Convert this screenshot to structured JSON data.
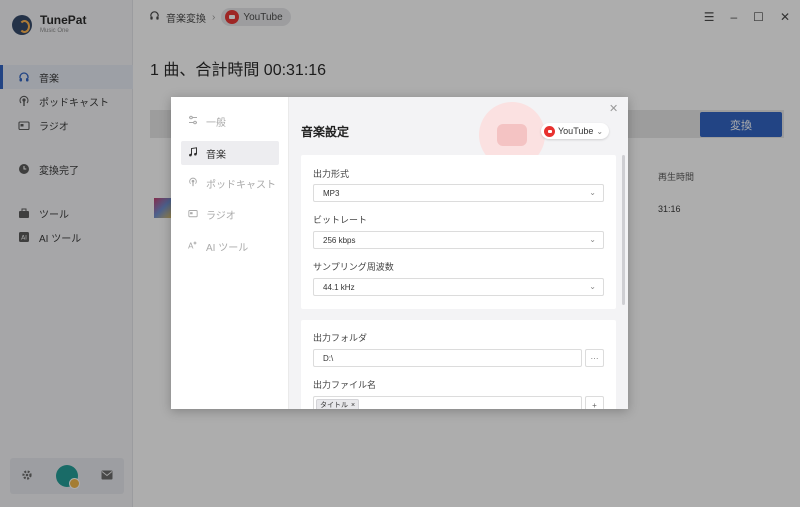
{
  "app": {
    "name": "TunePat",
    "subtitle": "Music One"
  },
  "sidebar": {
    "items": [
      {
        "label": "音楽",
        "icon": "headphones-icon",
        "active": true
      },
      {
        "label": "ポッドキャスト",
        "icon": "podcast-icon",
        "active": false
      },
      {
        "label": "ラジオ",
        "icon": "radio-icon",
        "active": false
      },
      {
        "label": "変換完了",
        "icon": "clock-icon",
        "active": false
      },
      {
        "label": "ツール",
        "icon": "toolbox-icon",
        "active": false
      },
      {
        "label": "AI ツール",
        "icon": "ai-icon",
        "active": false
      }
    ]
  },
  "topbar": {
    "crumb": "音楽変換",
    "source": "YouTube"
  },
  "main": {
    "title": "1 曲、合計時間 00:31:16",
    "convert_label": "変換",
    "column_duration": "再生時間",
    "track_duration": "31:16"
  },
  "dialog": {
    "nav": [
      {
        "label": "一般",
        "icon": "sliders-icon"
      },
      {
        "label": "音楽",
        "icon": "music-note-icon"
      },
      {
        "label": "ポッドキャスト",
        "icon": "podcast-icon"
      },
      {
        "label": "ラジオ",
        "icon": "radio-icon"
      },
      {
        "label": "AI ツール",
        "icon": "ai-icon"
      }
    ],
    "title": "音楽設定",
    "source": "YouTube",
    "output_format_label": "出力形式",
    "output_format_value": "MP3",
    "bitrate_label": "ビットレート",
    "bitrate_value": "256 kbps",
    "samplerate_label": "サンプリング周波数",
    "samplerate_value": "44.1 kHz",
    "output_folder_label": "出力フォルダ",
    "output_folder_value": "D:\\",
    "folder_browse": "···",
    "filename_label": "出力ファイル名",
    "filename_tag": "タイトル",
    "add_button": "+"
  }
}
